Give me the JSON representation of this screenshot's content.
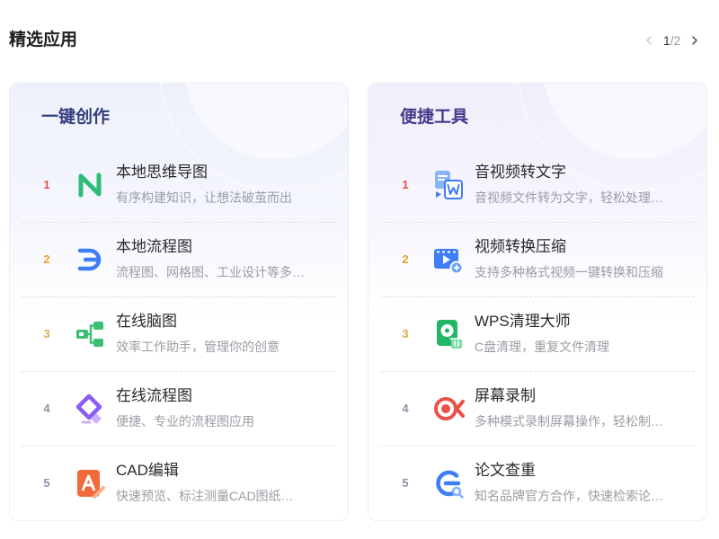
{
  "header": {
    "title": "精选应用",
    "pagination": {
      "current": "1",
      "rest": "/2"
    }
  },
  "cards": [
    {
      "title": "一键创作",
      "title_color": "#34407f",
      "items": [
        {
          "rank": "1",
          "icon": "mind-map-icon",
          "icon_color": "#2dbd7a",
          "title": "本地思维导图",
          "desc": "有序构建知识，让想法破茧而出"
        },
        {
          "rank": "2",
          "icon": "flowchart-icon",
          "icon_color": "#3d7df5",
          "title": "本地流程图",
          "desc": "流程图、网格图、工业设计等多…"
        },
        {
          "rank": "3",
          "icon": "brain-map-icon",
          "icon_color": "#3cbf72",
          "title": "在线脑图",
          "desc": "效率工作助手，管理你的创意"
        },
        {
          "rank": "4",
          "icon": "online-flowchart-icon",
          "icon_color": "#8a5cf5",
          "title": "在线流程图",
          "desc": "便捷、专业的流程图应用"
        },
        {
          "rank": "5",
          "icon": "cad-editor-icon",
          "icon_color": "#f26b3a",
          "title": "CAD编辑",
          "desc": "快速预览、标注测量CAD图纸…"
        }
      ]
    },
    {
      "title": "便捷工具",
      "title_color": "#463b8b",
      "items": [
        {
          "rank": "1",
          "icon": "audio-to-text-icon",
          "icon_color": "#3d7df5",
          "title": "音视频转文字",
          "desc": "音视频文件转为文字，轻松处理…"
        },
        {
          "rank": "2",
          "icon": "video-convert-icon",
          "icon_color": "#3d7df5",
          "title": "视频转换压缩",
          "desc": "支持多种格式视频一键转换和压缩"
        },
        {
          "rank": "3",
          "icon": "cleaner-icon",
          "icon_color": "#22b768",
          "title": "WPS清理大师",
          "desc": "C盘清理，重复文件清理"
        },
        {
          "rank": "4",
          "icon": "screen-record-icon",
          "icon_color": "#e9524a",
          "title": "屏幕录制",
          "desc": "多种模式录制屏幕操作，轻松制…"
        },
        {
          "rank": "5",
          "icon": "paper-check-icon",
          "icon_color": "#3d7df5",
          "title": "论文查重",
          "desc": "知名品牌官方合作，快速检索论…"
        }
      ]
    }
  ],
  "colors": {
    "rank": [
      "#e5504d",
      "#ef9e30",
      "#d9ad48",
      "#8d94a8",
      "#8d94a8"
    ],
    "pager_disabled": "#c4c6cc",
    "pager_active": "#4a4a4a"
  }
}
